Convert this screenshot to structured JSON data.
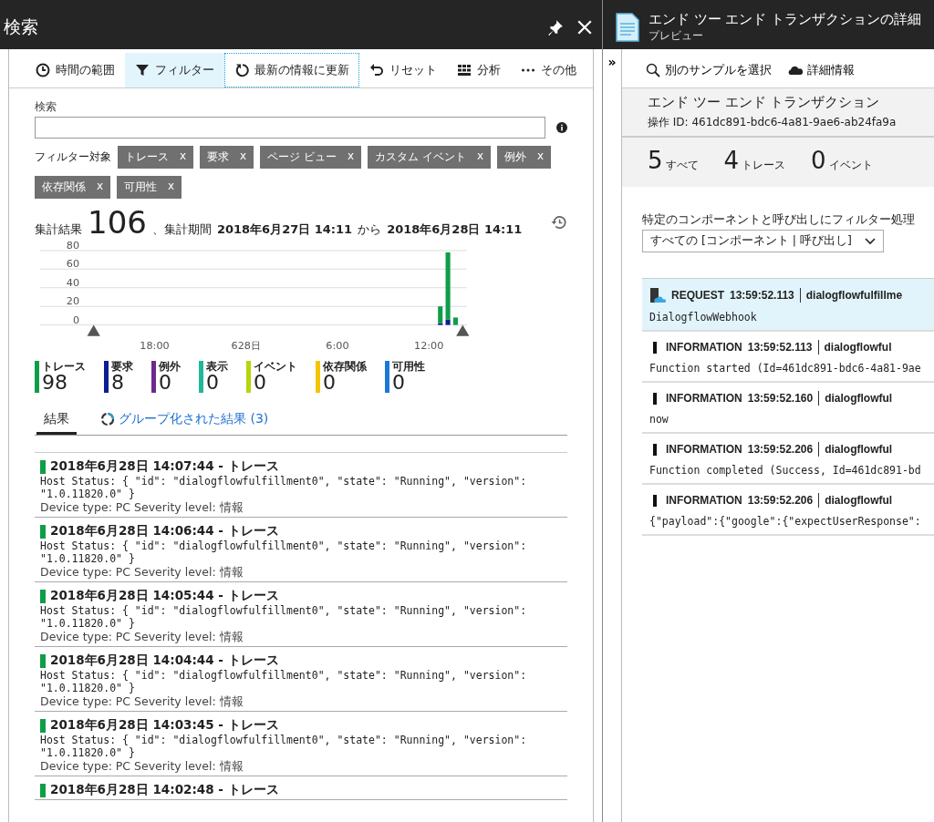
{
  "search_blade": {
    "title": "検索",
    "toolbar": [
      {
        "kind": "clock",
        "label": "時間の範囲",
        "selected": false,
        "focused": false
      },
      {
        "kind": "filter",
        "label": "フィルター",
        "selected": true,
        "focused": false
      },
      {
        "kind": "refresh",
        "label": "最新の情報に更新",
        "selected": false,
        "focused": true
      },
      {
        "kind": "reset",
        "label": "リセット",
        "selected": false,
        "focused": false
      },
      {
        "kind": "grid",
        "label": "分析",
        "selected": false,
        "focused": false
      },
      {
        "kind": "more",
        "label": "その他",
        "selected": false,
        "focused": false
      }
    ],
    "search": {
      "label": "検索"
    },
    "filter_label": "フィルター対象",
    "filter_chips": [
      {
        "label": "トレース",
        "close": "x"
      },
      {
        "label": "要求",
        "close": "x"
      },
      {
        "label": "ページ ビュー",
        "close": "x"
      },
      {
        "label": "カスタム イベント",
        "close": "x"
      },
      {
        "label": "例外",
        "close": "x"
      },
      {
        "label": "依存関係",
        "close": "x"
      },
      {
        "label": "可用性",
        "close": "x"
      }
    ],
    "summary": {
      "label": "集計結果",
      "total": "106",
      "period_label": "、集計期間",
      "from": "2018年6月27日 14:11",
      "from_word": "から",
      "to": "2018年6月28日 14:11"
    },
    "chart_data": {
      "type": "bar",
      "stacked": true,
      "grid": true,
      "ylim": [
        0,
        80
      ],
      "yticks": [
        0,
        20,
        40,
        60,
        80
      ],
      "categories": [
        null,
        null,
        null,
        null,
        null,
        null,
        null,
        null,
        null,
        null,
        null,
        null,
        null,
        null,
        null,
        "18:00",
        null,
        null,
        null,
        null,
        null,
        null,
        null,
        null,
        null,
        null,
        null,
        "628日",
        null,
        null,
        null,
        null,
        null,
        null,
        null,
        null,
        null,
        null,
        null,
        "6:00",
        null,
        null,
        null,
        null,
        null,
        null,
        null,
        null,
        null,
        null,
        null,
        "12:00",
        null,
        null,
        null,
        null
      ],
      "series": [
        {
          "color": "#0a1f8f",
          "values": [
            0,
            0,
            0,
            0,
            0,
            0,
            0,
            0,
            0,
            0,
            0,
            0,
            0,
            0,
            0,
            0,
            0,
            0,
            0,
            0,
            0,
            0,
            0,
            0,
            0,
            0,
            0,
            0,
            0,
            0,
            0,
            0,
            0,
            0,
            0,
            0,
            0,
            0,
            0,
            0,
            0,
            0,
            0,
            0,
            0,
            0,
            0,
            0,
            0,
            0,
            0,
            0,
            2,
            6,
            0,
            0
          ]
        },
        {
          "color": "#0e9e48",
          "values": [
            0,
            0,
            0,
            0,
            0,
            0,
            0,
            0,
            0,
            0,
            0,
            0,
            0,
            0,
            0,
            0,
            0,
            0,
            0,
            0,
            0,
            0,
            0,
            0,
            0,
            0,
            0,
            0,
            0,
            0,
            0,
            0,
            0,
            0,
            0,
            0,
            0,
            0,
            0,
            0,
            0,
            0,
            0,
            0,
            0,
            0,
            0,
            0,
            0,
            0,
            0,
            0,
            18,
            72,
            8,
            0
          ]
        }
      ]
    },
    "legend": [
      {
        "label": "トレース",
        "count": "98",
        "color": "#0e9e48"
      },
      {
        "label": "要求",
        "count": "8",
        "color": "#0a1f8f"
      },
      {
        "label": "例外",
        "count": "0",
        "color": "#6b2a8f"
      },
      {
        "label": "表示",
        "count": "0",
        "color": "#1fb89a"
      },
      {
        "label": "イベント",
        "count": "0",
        "color": "#b8d40a"
      },
      {
        "label": "依存関係",
        "count": "0",
        "color": "#f5c400"
      },
      {
        "label": "可用性",
        "count": "0",
        "color": "#1e78d2"
      }
    ],
    "tabs": [
      {
        "label": "結果",
        "selected": true,
        "loading": false
      },
      {
        "label": "グループ化された結果 (3)",
        "selected": false,
        "loading": true
      }
    ],
    "results": [
      {
        "title": "2018年6月28日 14:07:44 - トレース",
        "message": "Host Status: { \"id\": \"dialogflowfulfillment0\", \"state\": \"Running\", \"version\": \"1.0.11820.0\" }",
        "meta": "Device type: PC Severity level: 情報",
        "color": "#0e9e48"
      },
      {
        "title": "2018年6月28日 14:06:44 - トレース",
        "message": "Host Status: { \"id\": \"dialogflowfulfillment0\", \"state\": \"Running\", \"version\": \"1.0.11820.0\" }",
        "meta": "Device type: PC Severity level: 情報",
        "color": "#0e9e48"
      },
      {
        "title": "2018年6月28日 14:05:44 - トレース",
        "message": "Host Status: { \"id\": \"dialogflowfulfillment0\", \"state\": \"Running\", \"version\": \"1.0.11820.0\" }",
        "meta": "Device type: PC Severity level: 情報",
        "color": "#0e9e48"
      },
      {
        "title": "2018年6月28日 14:04:44 - トレース",
        "message": "Host Status: { \"id\": \"dialogflowfulfillment0\", \"state\": \"Running\", \"version\": \"1.0.11820.0\" }",
        "meta": "Device type: PC Severity level: 情報",
        "color": "#0e9e48"
      },
      {
        "title": "2018年6月28日 14:03:45 - トレース",
        "message": "Host Status: { \"id\": \"dialogflowfulfillment0\", \"state\": \"Running\", \"version\": \"1.0.11820.0\" }",
        "meta": "Device type: PC Severity level: 情報",
        "color": "#0e9e48"
      },
      {
        "title": "2018年6月28日 14:02:48 - トレース",
        "color": "#0e9e48"
      }
    ]
  },
  "detail_blade": {
    "title": "エンド ツー エンド トランザクションの詳細",
    "subtitle": "プレビュー",
    "expand": "»",
    "toolbar": [
      {
        "kind": "search",
        "label": "別のサンプルを選択"
      },
      {
        "kind": "cloud",
        "label": "詳細情報"
      }
    ],
    "heading": "エンド ツー エンド トランザクション",
    "operation_id": "操作 ID: 461dc891-bdc6-4a81-9ae6-ab24fa9a",
    "counts": [
      {
        "value": "5",
        "label": "すべて"
      },
      {
        "value": "4",
        "label": "トレース"
      },
      {
        "value": "0",
        "label": "イベント"
      }
    ],
    "filter": {
      "label": "特定のコンポーネントと呼び出しにフィルター処理",
      "value": "すべての [コンポーネント | 呼び出し]"
    },
    "timeline": [
      {
        "kind": "request",
        "type": "REQUEST",
        "time": "13:59:52.113",
        "source": "dialogflowfulfillme",
        "message": "DialogflowWebhook",
        "selected": true
      },
      {
        "kind": "information",
        "type": "INFORMATION",
        "time": "13:59:52.113",
        "source": "dialogflowful",
        "message": "Function started (Id=461dc891-bdc6-4a81-9ae",
        "selected": false
      },
      {
        "kind": "information",
        "type": "INFORMATION",
        "time": "13:59:52.160",
        "source": "dialogflowful",
        "message": "now",
        "selected": false
      },
      {
        "kind": "information",
        "type": "INFORMATION",
        "time": "13:59:52.206",
        "source": "dialogflowful",
        "message": "Function completed (Success, Id=461dc891-bd",
        "selected": false
      },
      {
        "kind": "information",
        "type": "INFORMATION",
        "time": "13:59:52.206",
        "source": "dialogflowful",
        "message": "{\"payload\":{\"google\":{\"expectUserResponse\":",
        "selected": false
      }
    ]
  }
}
